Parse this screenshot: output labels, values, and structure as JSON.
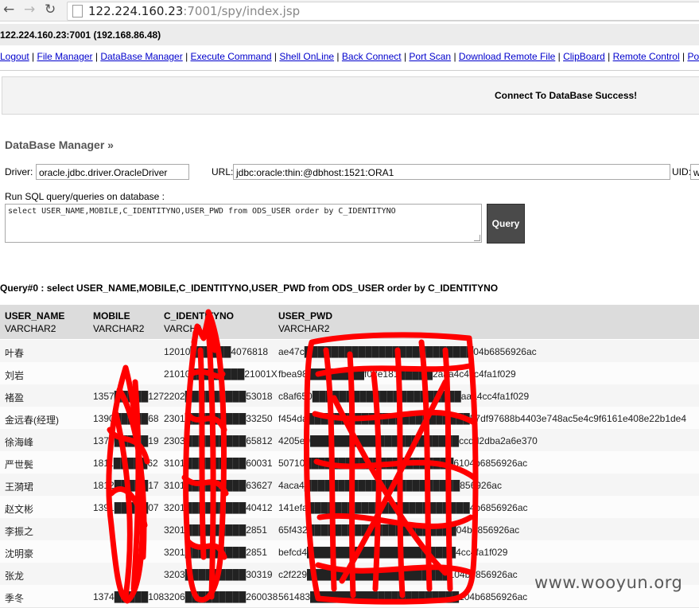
{
  "browser": {
    "url_host": "122.224.160.23",
    "url_rest": ":7001/spy/index.jsp",
    "back_icon": "arrow-left-icon",
    "forward_icon": "arrow-right-icon",
    "reload_icon": "reload-icon"
  },
  "host_line": "122.224.160.23:7001 (192.168.86.48)",
  "menu": [
    "Logout",
    "File Manager",
    "DataBase Manager",
    "Execute Command",
    "Shell OnLine",
    "Back Connect",
    "Port Scan",
    "Download Remote File",
    "ClipBoard",
    "Remote Control",
    "Port Map"
  ],
  "message": "Connect To DataBase Success!",
  "section_title": "DataBase Manager »",
  "form": {
    "driver_label": "Driver:",
    "driver_value": "oracle.jdbc.driver.OracleDriver",
    "url_label": "URL:",
    "url_value": "jdbc:oracle:thin:@dbhost:1521:ORA1",
    "uid_label": "UID:",
    "uid_value": "w",
    "sql_label": "Run SQL query/queries on database :",
    "sql_value": "select USER_NAME,MOBILE,C_IDENTITYNO,USER_PWD from ODS_USER order by C_IDENTITYNO",
    "query_button": "Query"
  },
  "query_title": "Query#0 : select USER_NAME,MOBILE,C_IDENTITYNO,USER_PWD from ODS_USER order by C_IDENTITYNO",
  "table": {
    "columns": [
      {
        "name": "USER_NAME",
        "type": "VARCHAR2"
      },
      {
        "name": "MOBILE",
        "type": "VARCHAR2"
      },
      {
        "name": "C_IDENTITYNO",
        "type": "VARCHAR2"
      },
      {
        "name": "USER_PWD",
        "type": "VARCHAR2"
      }
    ],
    "rows": [
      {
        "name": "叶春",
        "mobile": "",
        "id": "12010██████4076818",
        "pwd": "ae47c█████████████████████████04b6856926ac"
      },
      {
        "name": "刘岩",
        "mobile": "",
        "id": "21010████████21001X",
        "pwd": "fbea98f████████f02e181█████2aaa4c4cc4fa1f029"
      },
      {
        "name": "褚盈",
        "mobile": "1357█████127",
        "id": "2202█████████53018",
        "pwd": "c8af650██████████████████████aaa4cc4fa1f029"
      },
      {
        "name": "金远春(经理)",
        "mobile": "1390█████68",
        "id": "2301█████████33250",
        "pwd": "f454da████████████████████████57df97688b4403e748ac5e4c9f6161e408e22b1de4"
      },
      {
        "name": "徐海峰",
        "mobile": "1377█████19",
        "id": "2303█████████65812",
        "pwd": "4205e9██████████████████████ccdd2dba2a6e370"
      },
      {
        "name": "严世鬓",
        "mobile": "1811█████62",
        "id": "3101█████████60031",
        "pwd": "50710██████████████████████6104b6856926ac"
      },
      {
        "name": "王漪珺",
        "mobile": "1812█████17",
        "id": "3101█████████63627",
        "pwd": "4aca4███████████████████████856926ac"
      },
      {
        "name": "赵文彬",
        "mobile": "1391█████07",
        "id": "3201█████████40412",
        "pwd": "141efa████████████████████████4b6856926ac"
      },
      {
        "name": "李振之",
        "mobile": "",
        "id": "3201█████████2851",
        "pwd": "65f432██████████████████████04b6856926ac"
      },
      {
        "name": "沈明豪",
        "mobile": "",
        "id": "3201█████████2851",
        "pwd": "befcd4██████████████████████4cc4fa1f029"
      },
      {
        "name": "张龙",
        "mobile": "",
        "id": "3203█████████30319",
        "pwd": "c2f229█████████████████████104b6856926ac"
      },
      {
        "name": "季冬",
        "mobile": "1374█████108",
        "id": "3206█████████260038",
        "pwd": "561483██████████████████████104b6856926ac"
      }
    ]
  },
  "watermark": "www.wooyun.org",
  "colors": {
    "scribble": "#ff0000",
    "link": "#0000cc",
    "header_bg": "#dcdcdc"
  }
}
